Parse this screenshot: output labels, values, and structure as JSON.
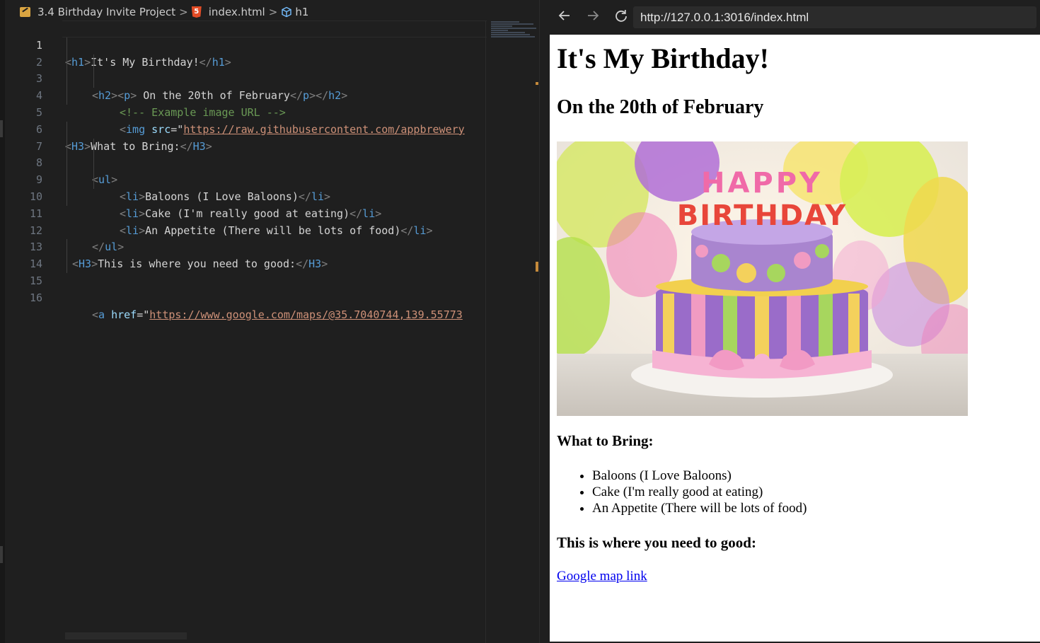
{
  "editor": {
    "breadcrumb": {
      "folder": "3.4 Birthday Invite Project",
      "file": "index.html",
      "html_icon_glyph": "5",
      "element": "h1",
      "separator": ">"
    },
    "lines": [
      {
        "num": "1"
      },
      {
        "num": "2"
      },
      {
        "num": "3"
      },
      {
        "num": "4"
      },
      {
        "num": "5"
      },
      {
        "num": "6"
      },
      {
        "num": "7"
      },
      {
        "num": "8"
      },
      {
        "num": "9"
      },
      {
        "num": "10"
      },
      {
        "num": "11"
      },
      {
        "num": "12"
      },
      {
        "num": "13"
      },
      {
        "num": "14"
      },
      {
        "num": "15"
      },
      {
        "num": "16"
      }
    ],
    "code": {
      "l1_tag": "h1",
      "l1_text": "It's My Birthday!",
      "l2_tag1": "h2",
      "l2_tag2": "p",
      "l2_text": " On the 20th of February",
      "l3_comment": "<!-- Example image URL -->",
      "l4_tag": "img",
      "l4_attr": "src",
      "l4_value": "https://raw.githubusercontent.com/appbrewery",
      "l6_tag": "H3",
      "l6_text": "What to Bring:",
      "l7_tag": "ul",
      "l8_text": "Baloons (I Love Baloons)",
      "l9_text": "Cake (I'm really good at eating)",
      "l10_text": "An Appetite (There will be lots of food)",
      "li_tag": "li",
      "l13_tag": "H3",
      "l13_text": "This is where you need to good:",
      "l15_tag": "a",
      "l15_attr": "href",
      "l15_value": "https://www.google.com/maps/@35.7040744,139.55773"
    }
  },
  "browser": {
    "back_icon": "arrow-left",
    "forward_icon": "arrow-right",
    "reload_icon": "reload",
    "url": "http://127.0.0.1:3016/index.html",
    "page": {
      "h1": "It's My Birthday!",
      "h2": "On the 20th of February",
      "image_alt": "Happy Birthday cake",
      "cake_topper": [
        "HAPPY",
        "BIRTHDAY"
      ],
      "h3_bring": "What to Bring:",
      "bring_items": [
        "Baloons (I Love Baloons)",
        "Cake (I'm really good at eating)",
        "An Appetite (There will be lots of food)"
      ],
      "h3_good": "This is where you need to good:",
      "link_text": "Google map link"
    }
  },
  "colors": {
    "editor_bg": "#1f1f1f",
    "tag": "#569cd6",
    "attr": "#9cdcfe",
    "string": "#ce9178",
    "comment": "#6a9955",
    "link": "#0000ee"
  }
}
